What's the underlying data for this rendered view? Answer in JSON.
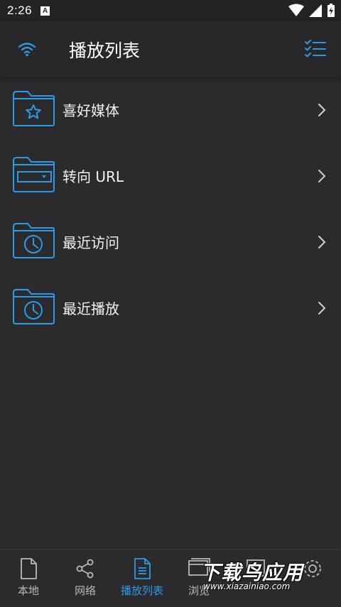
{
  "status_bar": {
    "time": "2:26",
    "notification_icon": "a-icon"
  },
  "app_bar": {
    "title": "播放列表",
    "left_icon": "wifi-icon",
    "right_icon": "checklist-icon",
    "accent_color": "#2b9be6"
  },
  "playlist": {
    "items": [
      {
        "label": "喜好媒体",
        "icon": "star-folder-icon"
      },
      {
        "label": "转向 URL",
        "icon": "url-folder-icon"
      },
      {
        "label": "最近访问",
        "icon": "clock-folder-icon"
      },
      {
        "label": "最近播放",
        "icon": "clock-folder-icon"
      }
    ]
  },
  "bottom_nav": {
    "items": [
      {
        "label": "本地",
        "icon": "file-icon",
        "active": false
      },
      {
        "label": "网络",
        "icon": "share-icon",
        "active": false
      },
      {
        "label": "播放列表",
        "icon": "document-icon",
        "active": true
      },
      {
        "label": "浏览",
        "icon": "browser-icon",
        "active": false
      }
    ]
  },
  "watermark": {
    "text": "下载鸟应用",
    "url": "www.xiazainiao.com"
  }
}
